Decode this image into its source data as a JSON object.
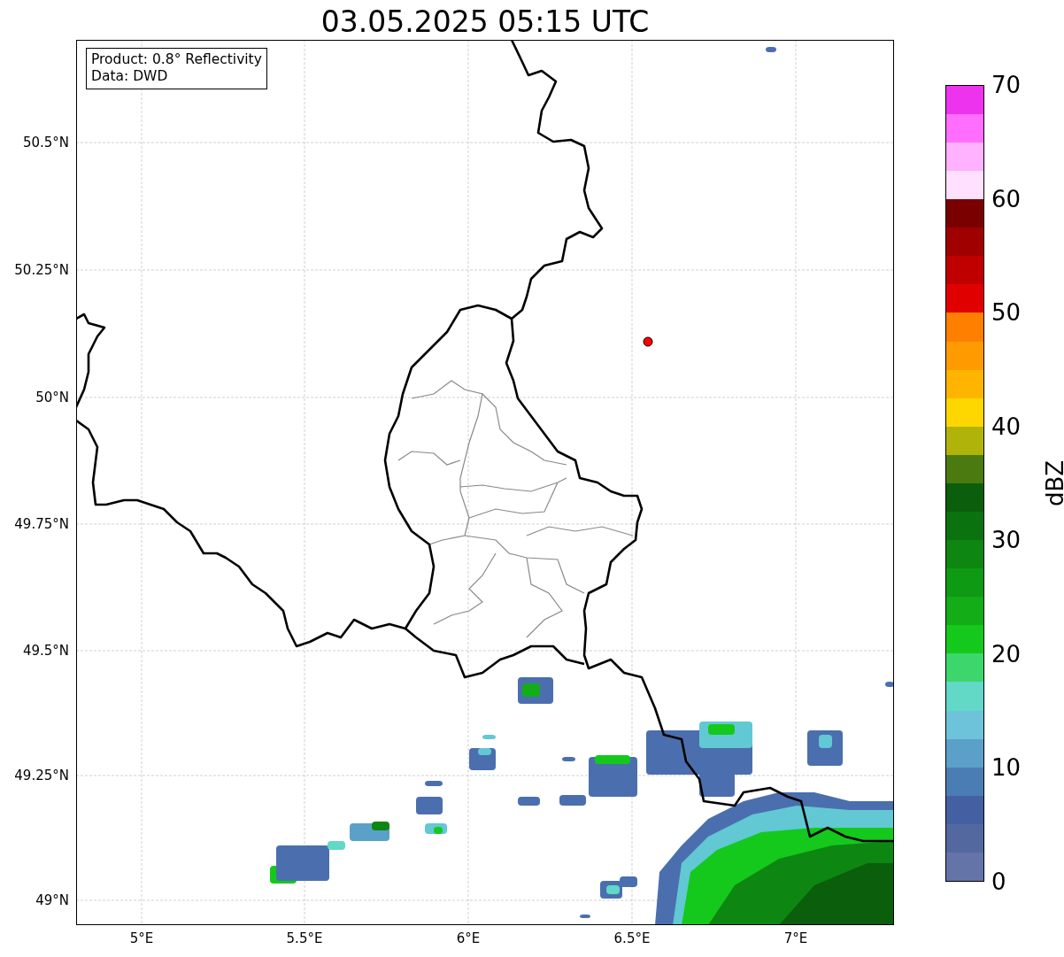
{
  "title": "03.05.2025 05:15 UTC",
  "legend": [
    "Product: 0.8° Reflectivity",
    "Data: DWD"
  ],
  "x_ticks": [
    "5°E",
    "5.5°E",
    "6°E",
    "6.5°E",
    "7°E"
  ],
  "y_ticks": [
    "50.5°N",
    "50.25°N",
    "50°N",
    "49.75°N",
    "49.5°N",
    "49.25°N",
    "49°N"
  ],
  "colorbar": {
    "label": "dBZ",
    "ticks": [
      "70",
      "60",
      "50",
      "40",
      "30",
      "20",
      "10",
      "0"
    ],
    "bins": [
      {
        "color": "#6574a8"
      },
      {
        "color": "#5468a0"
      },
      {
        "color": "#4560a2"
      },
      {
        "color": "#4b7db5"
      },
      {
        "color": "#5ba0c8"
      },
      {
        "color": "#6cc3da"
      },
      {
        "color": "#62d8c6"
      },
      {
        "color": "#3dd66c"
      },
      {
        "color": "#14c91b"
      },
      {
        "color": "#12ad17"
      },
      {
        "color": "#0f9a13"
      },
      {
        "color": "#0d8711"
      },
      {
        "color": "#0a730f"
      },
      {
        "color": "#0a5e0c"
      },
      {
        "color": "#4a7a10"
      },
      {
        "color": "#b0b40a"
      },
      {
        "color": "#ffd700"
      },
      {
        "color": "#ffb400"
      },
      {
        "color": "#ff9a00"
      },
      {
        "color": "#ff7f00"
      },
      {
        "color": "#e10000"
      },
      {
        "color": "#c00000"
      },
      {
        "color": "#a00000"
      },
      {
        "color": "#7a0000"
      },
      {
        "color": "#ffe0ff"
      },
      {
        "color": "#ffb2ff"
      },
      {
        "color": "#ff6eff"
      },
      {
        "color": "#ee33ee"
      }
    ]
  }
}
